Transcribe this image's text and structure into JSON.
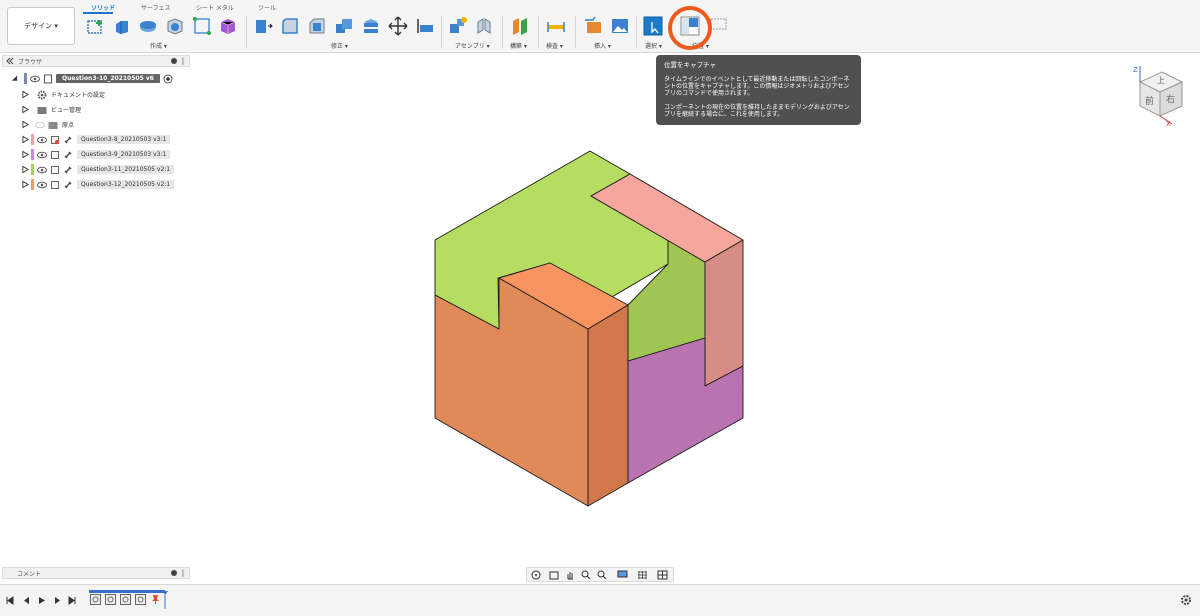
{
  "toolbar": {
    "workspace_label": "デザイン ▾",
    "tabs": [
      "ソリッド",
      "サーフェス",
      "シート メタル",
      "ツール"
    ],
    "groups": {
      "create": "作成 ▾",
      "modify": "修正 ▾",
      "assemble": "アセンブリ ▾",
      "construct": "構築 ▾",
      "inspect": "検査 ▾",
      "insert": "挿入 ▾",
      "select": "選択 ▾",
      "position": "位置 ▾"
    }
  },
  "tooltip": {
    "title": "位置をキャプチャ",
    "body1": "タイムラインでのイベントとして最近移動または回転したコンポーネントの位置をキャプチャします。この情報はジオメトリおよびアセンブリのコマンドで使用されます。",
    "body2": "コンポーネントの現在の位置を維持したままモデリングおよびアセンブリを継続する場合に、これを使用します。"
  },
  "highlight_color": "#ee5a1a",
  "browser": {
    "title": "ブラウザ",
    "root": "Question3-10_20210505 v6",
    "items": [
      {
        "label": "ドキュメントの設定"
      },
      {
        "label": "ビュー管理"
      },
      {
        "label": "原点"
      },
      {
        "label": "Question3-8_20210503 v3:1",
        "color": "#f4a3a3"
      },
      {
        "label": "Question3-9_20210503 v3:1",
        "color": "#c889d6"
      },
      {
        "label": "Question3-11_20210505 v2:1",
        "color": "#9bd65a"
      },
      {
        "label": "Question3-12_20210505 v2:1",
        "color": "#f29a64"
      }
    ]
  },
  "viewcube": {
    "front": "前",
    "right": "右",
    "top": "上",
    "axis_x": "X",
    "axis_z": "Z"
  },
  "comments": {
    "label": "コメント"
  },
  "cube_colors": {
    "green": "#b6dc62",
    "green_dark": "#a0c553",
    "orange_front": "#e08a5a",
    "orange_side": "#d0784a",
    "orange_top": "#f7945f",
    "pink_top": "#f5a69d",
    "pink_side": "#d78c85",
    "purple": "#b873b0"
  }
}
